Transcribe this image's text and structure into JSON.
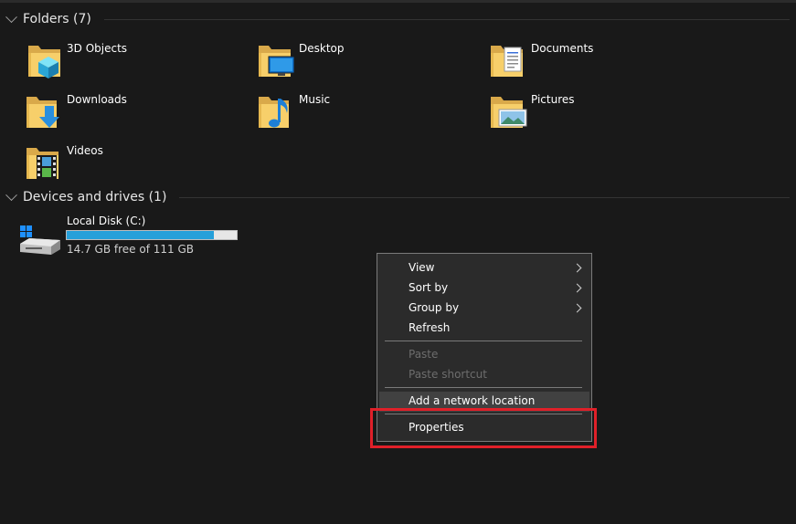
{
  "folders_group": {
    "title": "Folders (7)"
  },
  "folders": [
    {
      "name": "3D Objects",
      "icon": "3d-objects-folder-icon"
    },
    {
      "name": "Desktop",
      "icon": "desktop-folder-icon"
    },
    {
      "name": "Documents",
      "icon": "documents-folder-icon"
    },
    {
      "name": "Downloads",
      "icon": "downloads-folder-icon"
    },
    {
      "name": "Music",
      "icon": "music-folder-icon"
    },
    {
      "name": "Pictures",
      "icon": "pictures-folder-icon"
    },
    {
      "name": "Videos",
      "icon": "videos-folder-icon"
    }
  ],
  "devices_group": {
    "title": "Devices and drives (1)"
  },
  "drive": {
    "name": "Local Disk (C:)",
    "info": "14.7 GB free of 111 GB",
    "used_fraction": 0.868,
    "icon": "hard-drive-icon"
  },
  "context_menu": {
    "items": [
      {
        "label": "View",
        "submenu": true,
        "enabled": true
      },
      {
        "label": "Sort by",
        "submenu": true,
        "enabled": true
      },
      {
        "label": "Group by",
        "submenu": true,
        "enabled": true
      },
      {
        "label": "Refresh",
        "submenu": false,
        "enabled": true
      },
      {
        "label": "Paste",
        "submenu": false,
        "enabled": false
      },
      {
        "label": "Paste shortcut",
        "submenu": false,
        "enabled": false
      },
      {
        "label": "Add a network location",
        "submenu": false,
        "enabled": true
      },
      {
        "label": "Properties",
        "submenu": false,
        "enabled": true
      }
    ]
  },
  "colors": {
    "background": "#191919",
    "menu_background": "#2b2b2b",
    "drive_bar_fill": "#26a0da",
    "highlight_border": "#e02029",
    "folder_yellow": "#f7cf6a"
  }
}
